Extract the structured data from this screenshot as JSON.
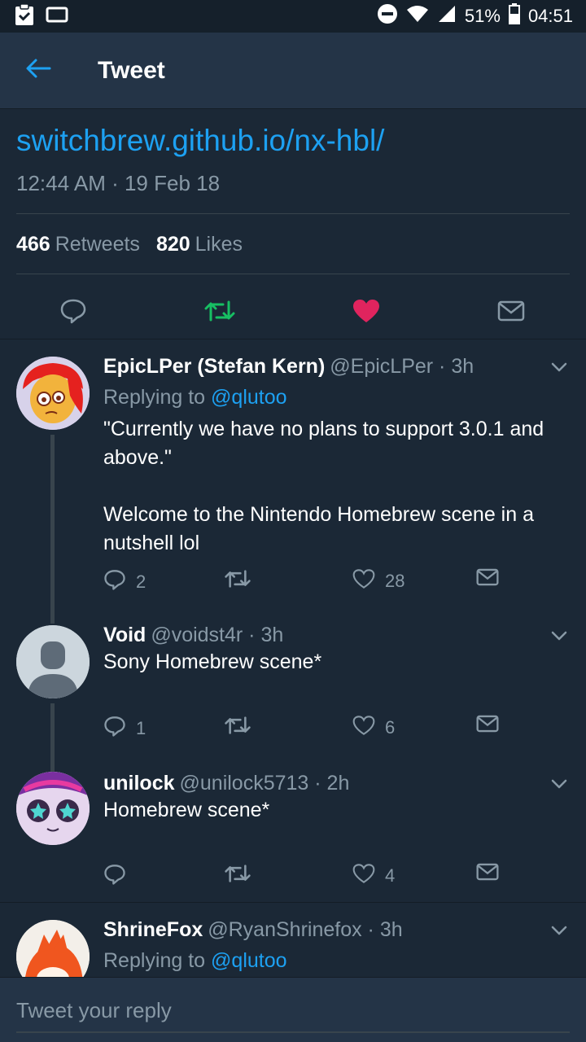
{
  "status_bar": {
    "battery": "51%",
    "time": "04:51"
  },
  "header": {
    "title": "Tweet"
  },
  "tweet": {
    "link": "switchbrew.github.io/nx-hbl/",
    "timestamp": "12:44 AM · 19 Feb 18",
    "retweets_count": "466",
    "retweets_label": "Retweets",
    "likes_count": "820",
    "likes_label": "Likes"
  },
  "replies": [
    {
      "name": "EpicLPer (Stefan Kern)",
      "handle_time": "@EpicLPer · 3h",
      "replying_prefix": "Replying to",
      "replying_to": "@qlutoo",
      "text": "\"Currently we have no plans to support 3.0.1 and above.\"\n\nWelcome to the Nintendo Homebrew scene in a nutshell lol",
      "reply_count": "2",
      "like_count": "28"
    },
    {
      "name": "Void",
      "handle_time": "@voidst4r · 3h",
      "text": "Sony Homebrew scene*",
      "reply_count": "1",
      "like_count": "6"
    },
    {
      "name": "unilock",
      "handle_time": "@unilock5713 · 2h",
      "text": "Homebrew scene*",
      "like_count": "4"
    },
    {
      "name": "ShrineFox",
      "handle_time": "@RyanShrinefox · 3h",
      "replying_prefix": "Replying to",
      "replying_to": "@qlutoo"
    }
  ],
  "reply_box": {
    "placeholder": "Tweet your reply"
  },
  "colors": {
    "background": "#1b2836",
    "header": "#243447",
    "accent": "#1da1f2",
    "retweet": "#17bf63",
    "like": "#e0245e",
    "secondary_text": "#8899a6"
  }
}
